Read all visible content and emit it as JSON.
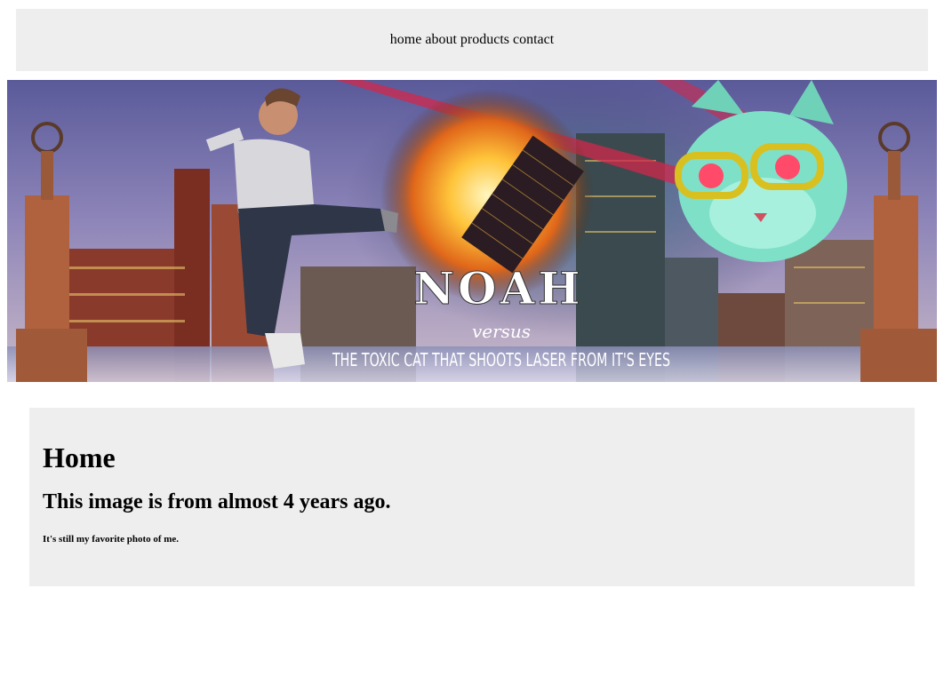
{
  "nav": {
    "items": [
      {
        "label": "home"
      },
      {
        "label": "about"
      },
      {
        "label": "products"
      },
      {
        "label": "contact"
      }
    ]
  },
  "banner": {
    "title": "NOAH",
    "versus": "versus",
    "subtitle": "THE TOXIC CAT THAT SHOOTS LASER FROM IT'S EYES"
  },
  "content": {
    "heading": "Home",
    "subheading": "This image is from almost 4 years ago.",
    "note": "It's still my favorite photo of me."
  },
  "colors": {
    "panel_bg": "#eeeeee",
    "laser": "#d0284c",
    "explosion": "#f7a21b"
  }
}
